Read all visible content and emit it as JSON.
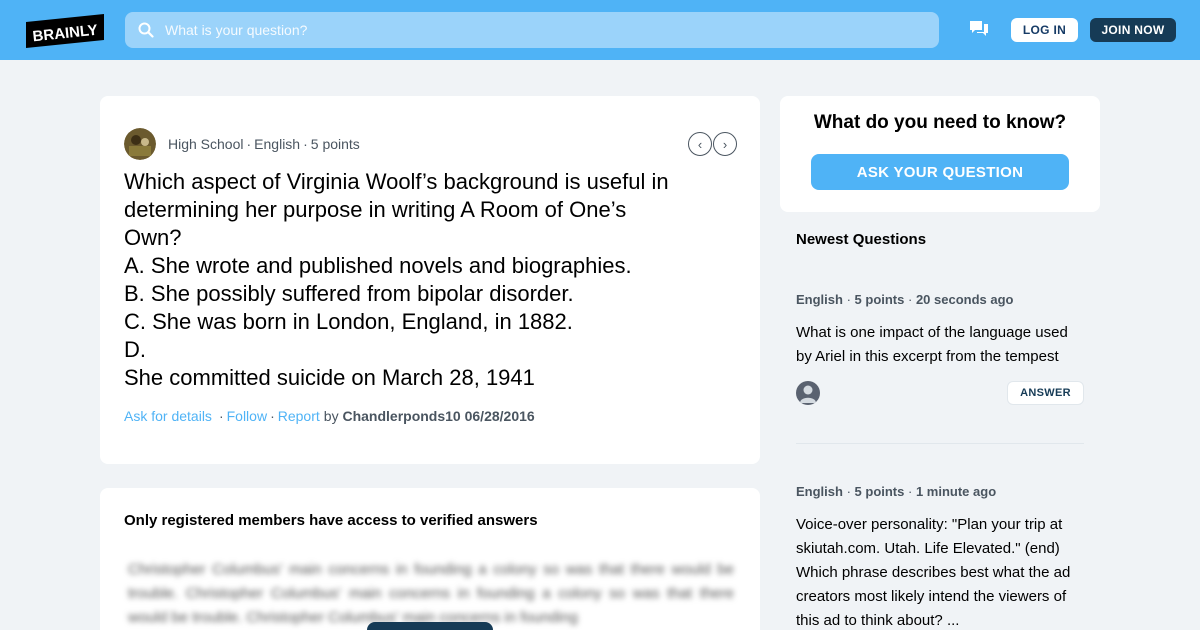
{
  "header": {
    "logo_text": "BRAINLY",
    "search_placeholder": "What is your question?",
    "login_label": "LOG IN",
    "join_label": "JOIN NOW",
    "brand_color": "#4fb3f6",
    "dark_color": "#163b56"
  },
  "question": {
    "level": "High School",
    "subject": "English",
    "points": "5 points",
    "lines": [
      "Which aspect of Virginia Woolf’s background is useful in",
      "determining her purpose in writing A Room of One’s",
      "Own?",
      "A. She wrote and published novels and biographies.",
      "B. She possibly suffered from bipolar disorder.",
      "C. She was born in London, England, in 1882.",
      "D.",
      "She committed suicide on March 28, 1941"
    ],
    "actions": {
      "ask_details": "Ask for details",
      "follow": "Follow",
      "report": "Report",
      "by": "by",
      "author": "Chandlerponds10",
      "date": "06/28/2016"
    }
  },
  "answer": {
    "title": "Only registered members have access to verified answers",
    "blurred_text": "Christopher Columbus' main concerns in founding a colony so was that there would be trouble. Christopher Columbus' main concerns in founding a colony so was that there would be trouble. Christopher Columbus' main concerns in founding"
  },
  "sidebar": {
    "ask_title": "What do you need to know?",
    "ask_button": "ASK YOUR QUESTION",
    "newest_title": "Newest Questions",
    "questions": [
      {
        "subject": "English",
        "points": "5 points",
        "time": "20 seconds ago",
        "text": "What is one impact of the language used by Ariel in this excerpt from the tempest",
        "answer_label": "ANSWER"
      },
      {
        "subject": "English",
        "points": "5 points",
        "time": "1 minute ago",
        "text": "Voice-over personality: \"Plan your trip at skiutah.com. Utah. Life Elevated.\" (end) Which phrase describes best what the ad creators most likely intend the viewers of this ad to think about? ...",
        "answer_label": "ANSWER"
      }
    ]
  }
}
